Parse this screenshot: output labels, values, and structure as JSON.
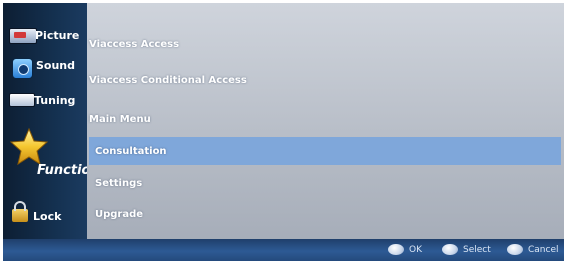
{
  "sidebar": {
    "categories": [
      {
        "id": "picture",
        "label": "Picture",
        "icon": "picture-icon"
      },
      {
        "id": "sound",
        "label": "Sound",
        "icon": "sound-icon"
      },
      {
        "id": "tuning",
        "label": "Tuning",
        "icon": "tuning-icon"
      },
      {
        "id": "function",
        "label": "Functio",
        "icon": "star-icon",
        "selected": true
      },
      {
        "id": "lock",
        "label": "Lock",
        "icon": "padlock-icon"
      }
    ]
  },
  "menu": {
    "items": [
      {
        "label": "Viaccess Access"
      },
      {
        "label": "Viaccess Conditional Access"
      },
      {
        "label": "Main Menu"
      },
      {
        "label": "Consultation",
        "highlighted": true
      },
      {
        "label": "Settings"
      },
      {
        "label": "Upgrade"
      }
    ]
  },
  "help": {
    "ok": "OK",
    "select": "Select",
    "cancel": "Cancel"
  },
  "colors": {
    "sidebar": "#14304f",
    "highlight": "#7fa7da",
    "helpbar": "#2d5a94"
  }
}
